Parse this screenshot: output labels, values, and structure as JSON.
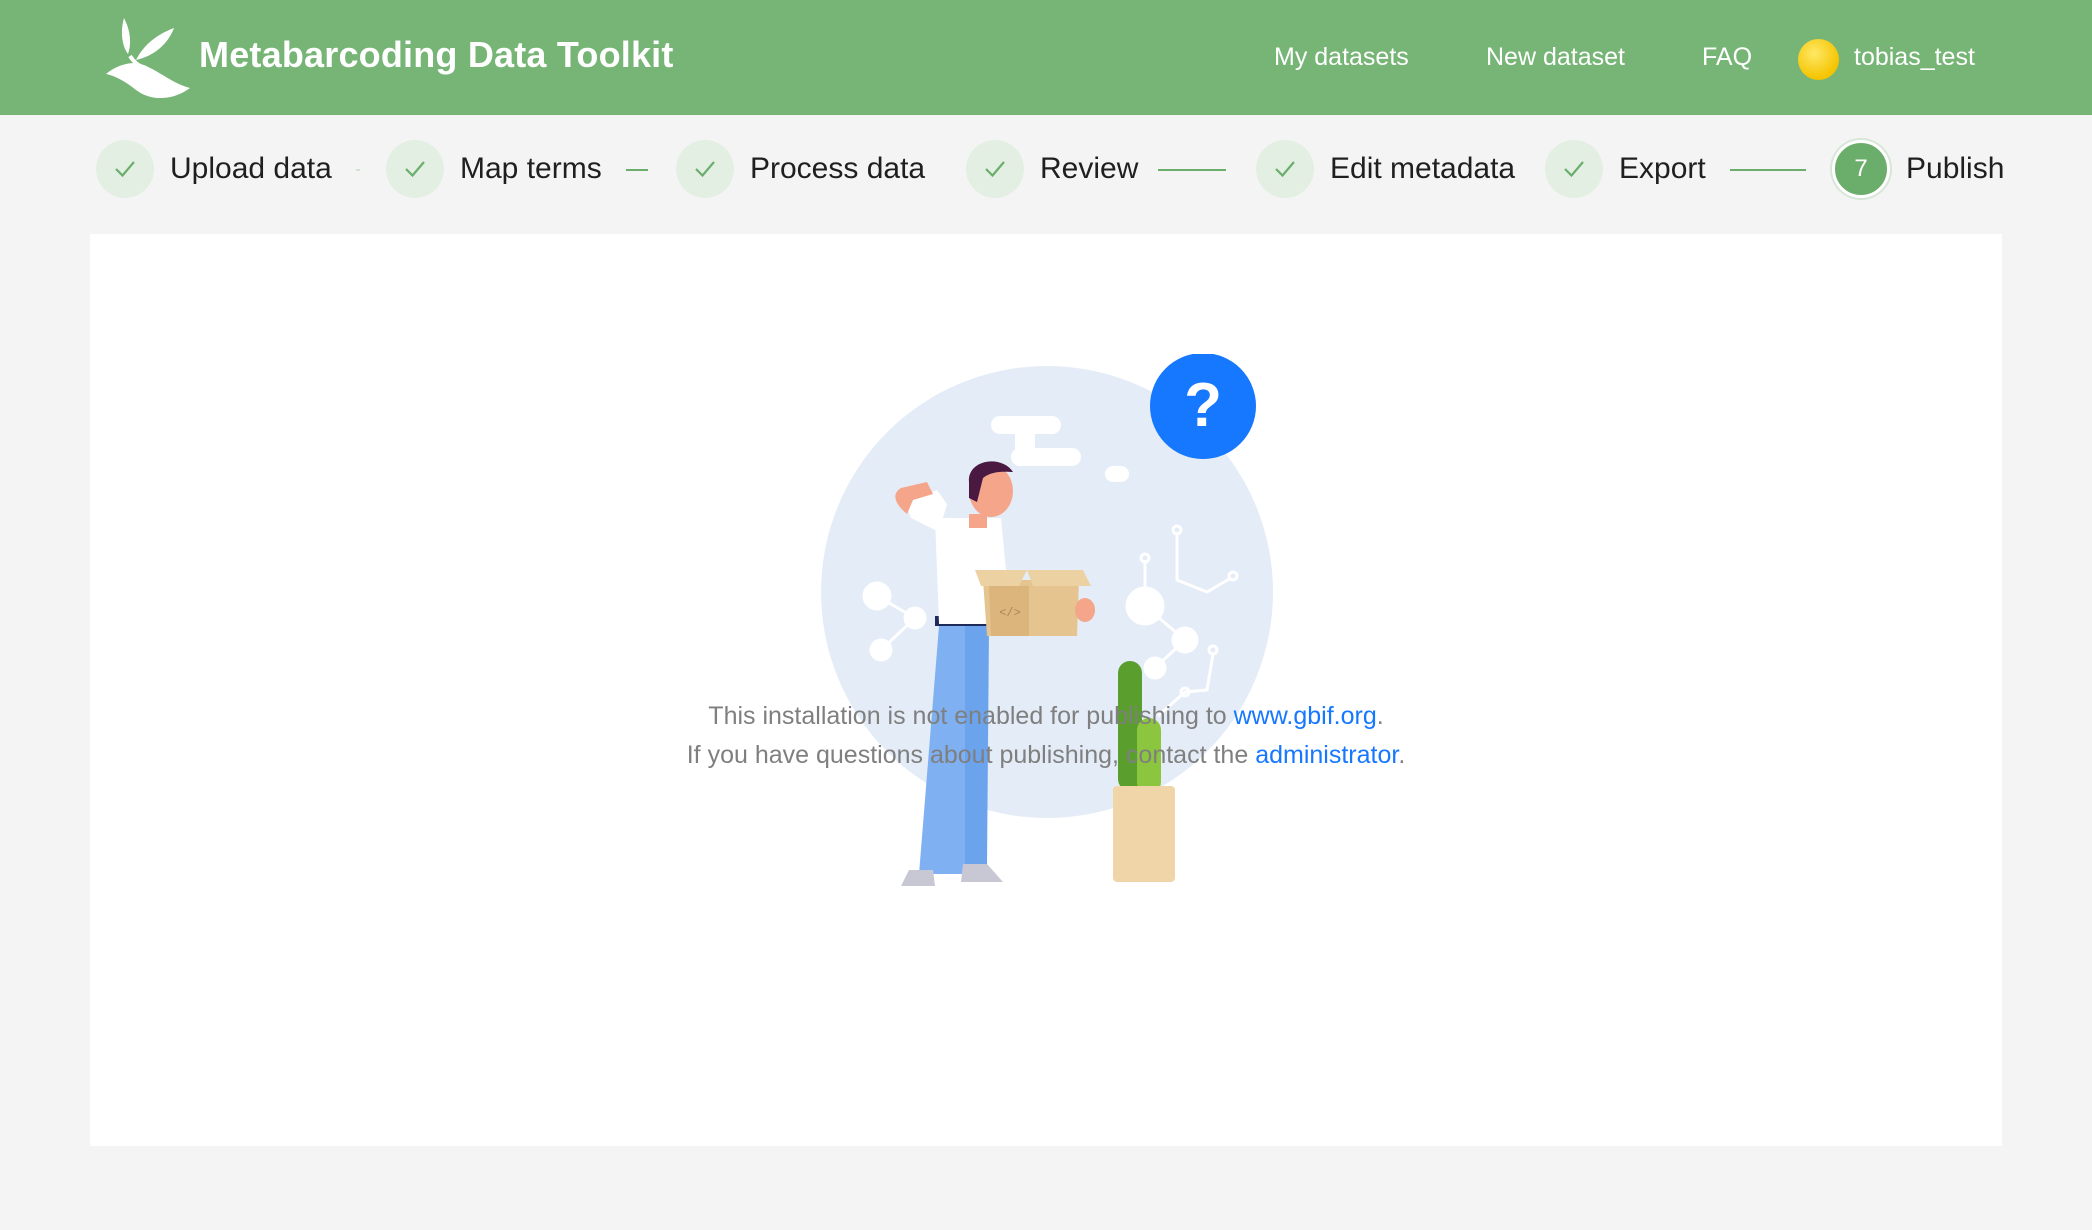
{
  "header": {
    "brand": "Metabarcoding Data Toolkit",
    "nav": [
      "My datasets",
      "New dataset",
      "FAQ"
    ],
    "username": "tobias_test",
    "logo_icon": "leaf-plant-icon",
    "avatar_color": "#f5c400",
    "bar_color": "#77b577"
  },
  "steps": [
    {
      "label": "Upload data",
      "status": "done"
    },
    {
      "label": "Map terms",
      "status": "done"
    },
    {
      "label": "Process data",
      "status": "done"
    },
    {
      "label": "Review",
      "status": "done"
    },
    {
      "label": "Edit metadata",
      "status": "done"
    },
    {
      "label": "Export",
      "status": "done"
    },
    {
      "label": "Publish",
      "status": "active",
      "number": "7"
    }
  ],
  "main": {
    "line1_text": "This installation is not enabled for publishing to ",
    "line1_link": "www.gbif.org",
    "line1_end": ".",
    "line2_text": "If you have questions about publishing, contact the ",
    "line2_link": "administrator",
    "line2_end": ".",
    "illustration_icon": "question-mark-icon",
    "link_color": "#1677ff"
  }
}
